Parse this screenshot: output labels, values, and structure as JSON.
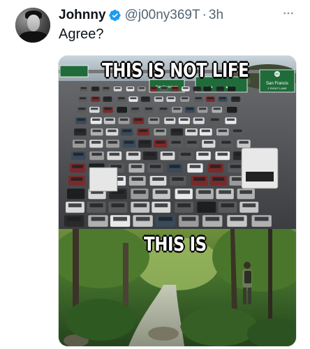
{
  "tweet": {
    "author_name": "Johnny",
    "handle": "@j00ny369T",
    "separator": "·",
    "time": "3h",
    "text": "Agree?",
    "more_icon": "more-horizontal-icon",
    "verified_icon": "verified-badge-icon",
    "verified_color": "#1d9bf0"
  },
  "media": {
    "top_caption": "THIS IS NOT LIFE",
    "bottom_caption": "THIS IS",
    "top_scene": "highway traffic jam",
    "bottom_scene": "forest stream with hiker",
    "signs": {
      "left_sign": "San Francisco",
      "right_sign_line1": "San Francis",
      "right_sign_line2": "2 RIGHT LANE",
      "right_route": "80"
    }
  }
}
